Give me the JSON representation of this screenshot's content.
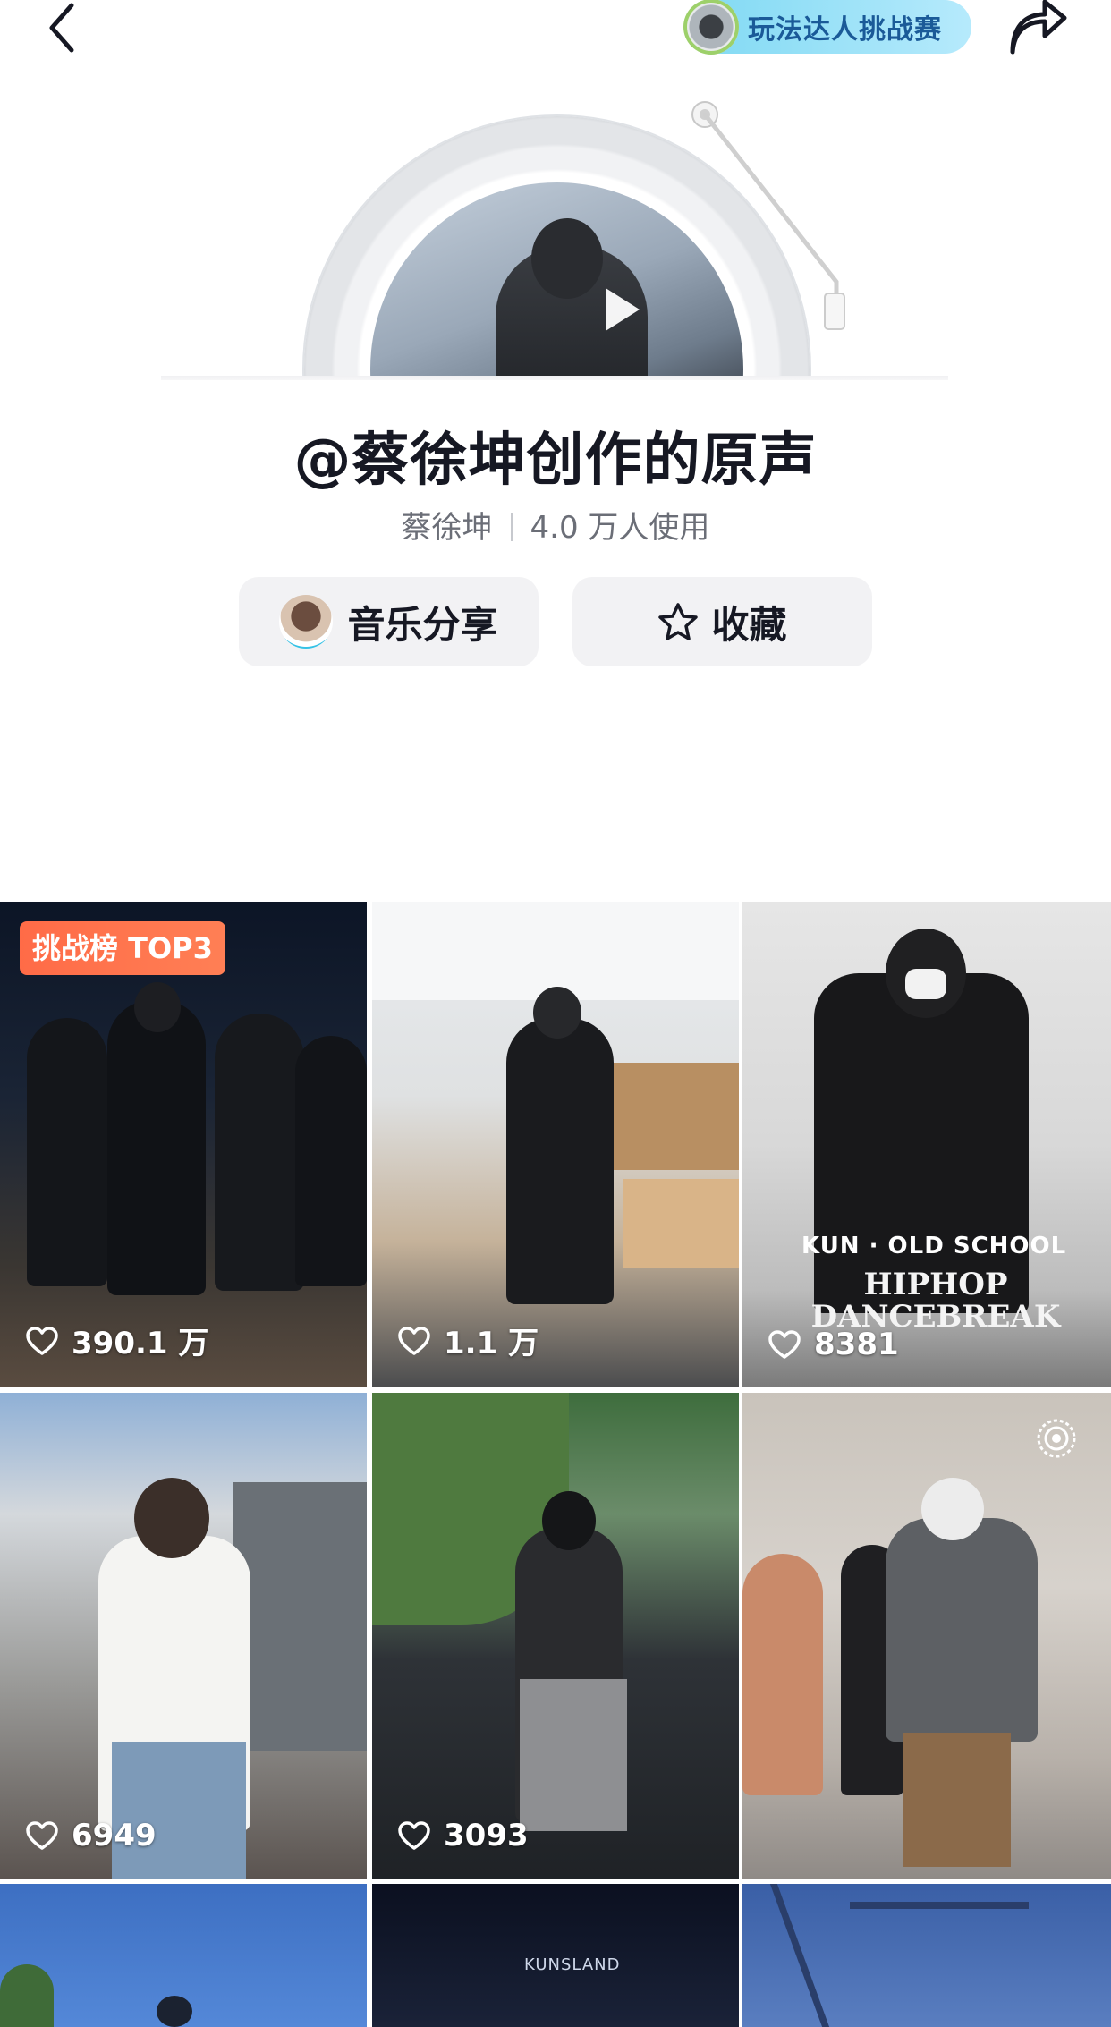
{
  "header": {
    "back_icon": "chevron-left-icon",
    "challenge_label": "玩法达人挑战赛",
    "share_icon": "share-arrow-icon"
  },
  "sound": {
    "title": "@蔡徐坤创作的原声",
    "author": "蔡徐坤",
    "usage": "4.0 万人使用"
  },
  "actions": {
    "music_share_label": "音乐分享",
    "favorite_label": "收藏"
  },
  "videos": [
    {
      "badge": "挑战榜 TOP3",
      "likes": "390.1 万"
    },
    {
      "likes": "1.1 万"
    },
    {
      "caption_line1": "KUN · OLD SCHOOL",
      "caption_line2": "HIPHOP DANCEBREAK",
      "likes": "8381"
    },
    {
      "likes": "6949"
    },
    {
      "likes": "3093"
    },
    {
      "icon": "live-signal-icon"
    },
    {},
    {
      "logo": "KUNSLAND"
    },
    {}
  ],
  "colors": {
    "challenge_pill": "#9ee2f7",
    "top3_badge": "#ff7050",
    "title_text": "#161823"
  }
}
